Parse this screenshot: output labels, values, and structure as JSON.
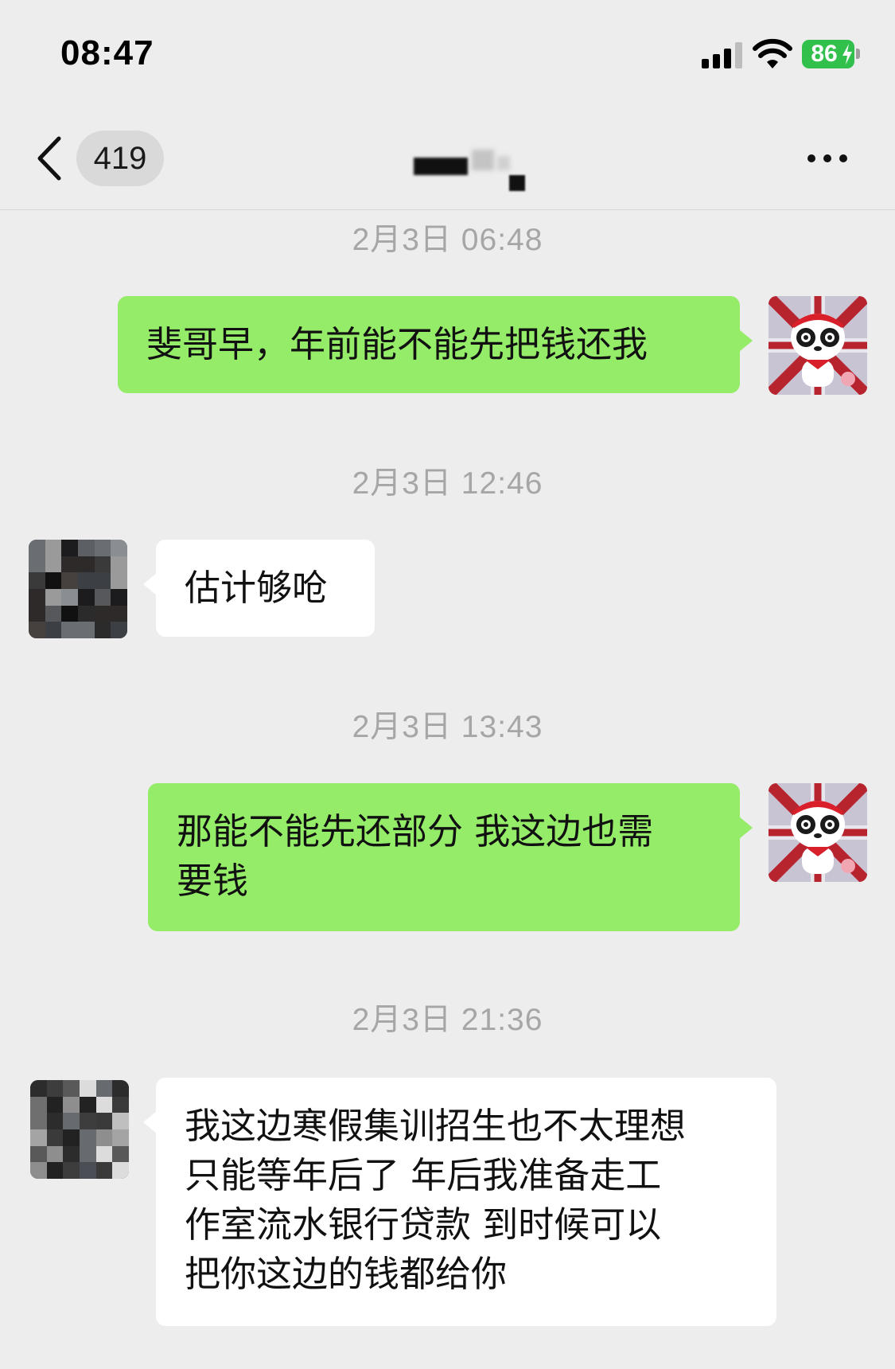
{
  "status_bar": {
    "time": "08:47",
    "battery_percent": "86",
    "battery_color": "#31c04b",
    "icons": [
      "signal-icon",
      "wifi-icon",
      "battery-icon",
      "charging-bolt-icon"
    ]
  },
  "nav": {
    "back_icon": "chevron-left-icon",
    "unread_count": "419",
    "title_redacted": true,
    "more_icon": "ellipsis-icon"
  },
  "colors": {
    "background": "#ededed",
    "my_bubble": "#95ec69",
    "their_bubble": "#ffffff",
    "timestamp": "#a6a6a6"
  },
  "messages": [
    {
      "type": "timestamp",
      "text": "2月3日 06:48"
    },
    {
      "type": "sent",
      "text": "斐哥早，年前能不能先把钱还我",
      "avatar": "panda-avatar"
    },
    {
      "type": "timestamp",
      "text": "2月3日 12:46"
    },
    {
      "type": "received",
      "text": "估计够呛",
      "avatar": "pixelated-avatar"
    },
    {
      "type": "timestamp",
      "text": "2月3日 13:43"
    },
    {
      "type": "sent",
      "lines": [
        "那能不能先还部分 我这边也需",
        "要钱"
      ],
      "avatar": "panda-avatar"
    },
    {
      "type": "timestamp",
      "text": "2月3日 21:36"
    },
    {
      "type": "received",
      "lines": [
        "我这边寒假集训招生也不太理想",
        "只能等年后了 年后我准备走工",
        "作室流水银行贷款 到时候可以",
        "把你这边的钱都给你"
      ],
      "avatar": "pixelated-avatar"
    }
  ]
}
